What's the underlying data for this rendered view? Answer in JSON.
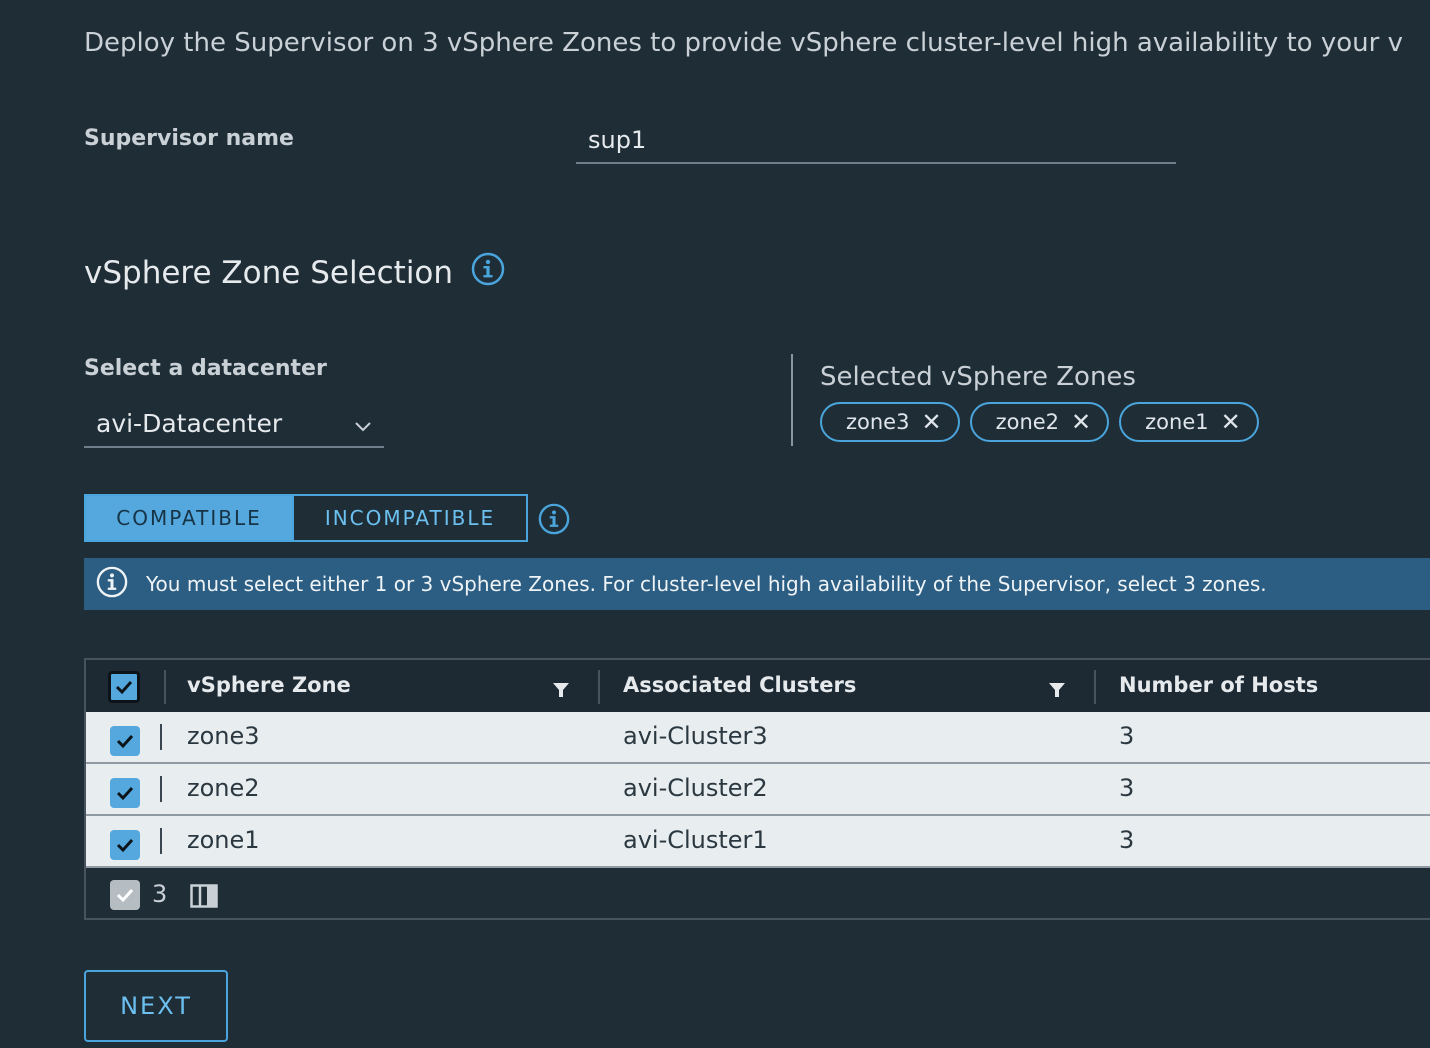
{
  "intro_text": "Deploy the Supervisor on 3 vSphere Zones to provide vSphere cluster-level high availability to your v",
  "supervisor_name": {
    "label": "Supervisor name",
    "value": "sup1"
  },
  "zone_section": {
    "title": "vSphere Zone Selection"
  },
  "datacenter": {
    "label": "Select a datacenter",
    "value": "avi-Datacenter"
  },
  "selected_zones": {
    "label": "Selected vSphere Zones",
    "chips": [
      "zone3",
      "zone2",
      "zone1"
    ]
  },
  "tabs": {
    "compatible": "COMPATIBLE",
    "incompatible": "INCOMPATIBLE",
    "active": "COMPATIBLE"
  },
  "alert_text": "You must select either 1 or 3 vSphere Zones. For cluster-level high availability of the Supervisor, select 3 zones.",
  "table": {
    "columns": [
      "vSphere Zone",
      "Associated Clusters",
      "Number of Hosts"
    ],
    "rows": [
      {
        "zone": "zone3",
        "cluster": "avi-Cluster3",
        "hosts": "3",
        "checked": true
      },
      {
        "zone": "zone2",
        "cluster": "avi-Cluster2",
        "hosts": "3",
        "checked": true
      },
      {
        "zone": "zone1",
        "cluster": "avi-Cluster1",
        "hosts": "3",
        "checked": true
      }
    ],
    "selected_count": "3"
  },
  "next_label": "NEXT",
  "colors": {
    "background": "#1f2d37",
    "accent": "#54a8dd",
    "alert_bg": "#2c5d82",
    "row_bg": "#e8edf0"
  },
  "icons": [
    "info-icon",
    "chevron-down-icon",
    "close-icon",
    "filter-icon",
    "checkmark-icon",
    "column-toggle-icon"
  ]
}
